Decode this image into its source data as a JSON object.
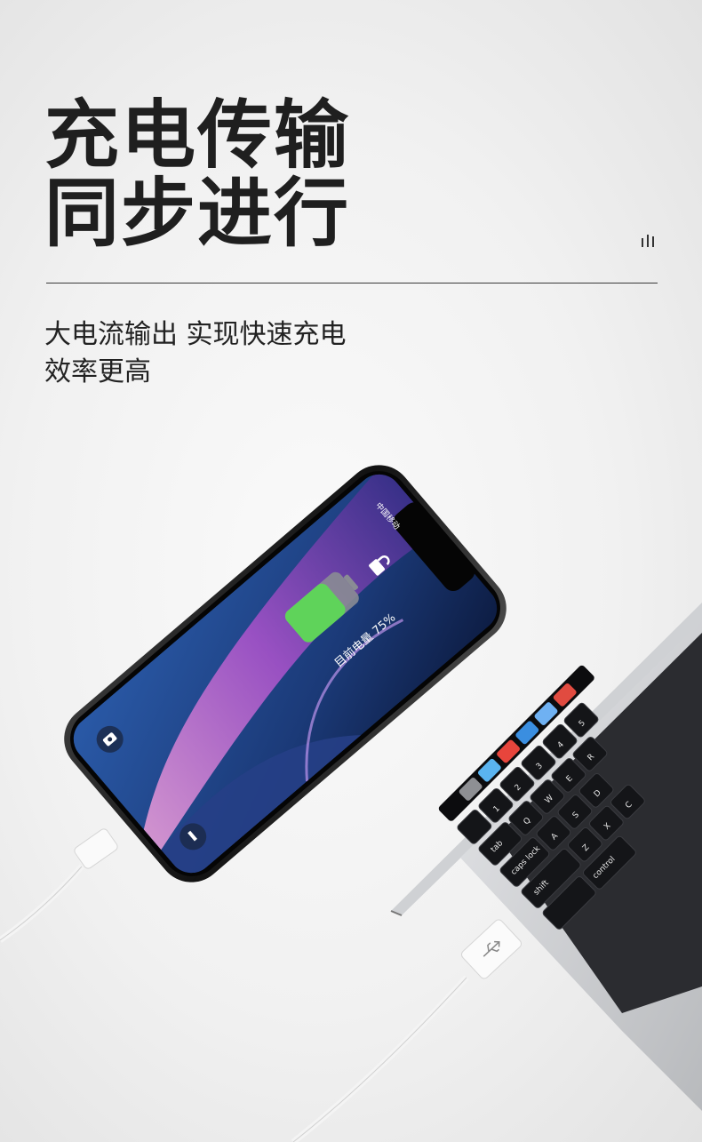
{
  "headline": {
    "line1": "充电传输",
    "line2": "同步进行"
  },
  "subtitle": {
    "line1": "大电流输出 实现快速充电",
    "line2": "效率更高"
  },
  "phone": {
    "carrier": "中国移动",
    "battery_text": "目前电量 75%",
    "battery_level": 0.75
  },
  "keyboard": {
    "keys_row1": [
      "Q",
      "W",
      "E",
      "R"
    ],
    "keys_row2": [
      "A",
      "S",
      "D"
    ],
    "keys_row3": [
      "Z",
      "X",
      "C"
    ],
    "caps_label": "caps lock",
    "tab_label": "tab",
    "shift_label": "shift",
    "control_label": "control",
    "number_keys": [
      "1",
      "2",
      "3",
      "4",
      "5"
    ]
  },
  "colors": {
    "battery_green": "#5fd35a",
    "wallpaper_pink": "#c66fd6",
    "wallpaper_blue": "#1b3a78"
  }
}
